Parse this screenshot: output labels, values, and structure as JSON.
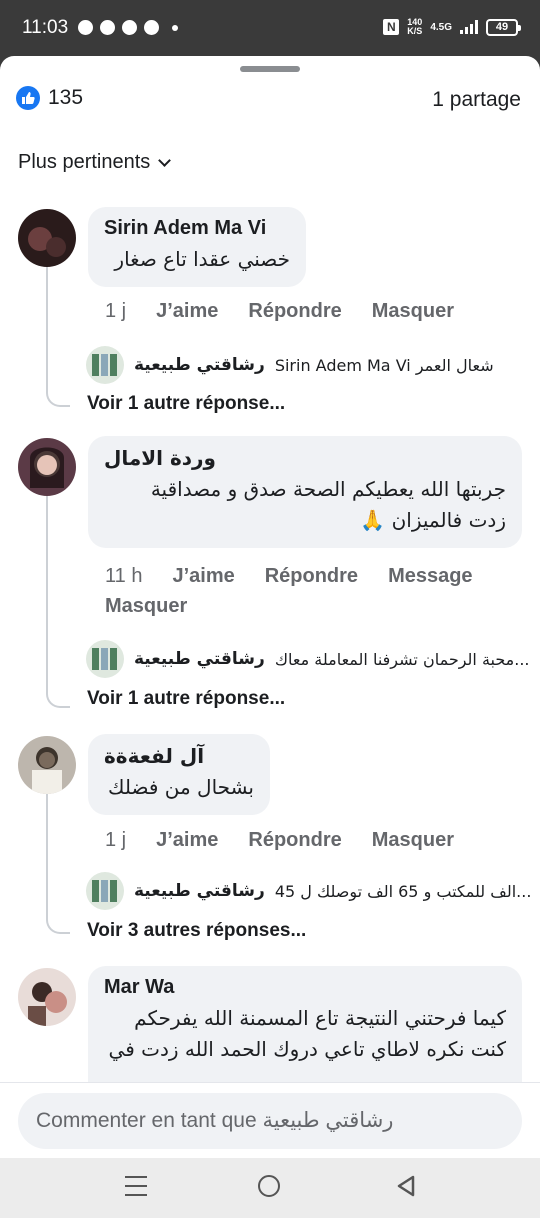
{
  "status_bar": {
    "time": "11:03",
    "speed_value": "140",
    "speed_unit": "K/S",
    "network": "4.5G",
    "battery": "49"
  },
  "post": {
    "like_count": "135",
    "shares": "1 partage",
    "sort_label": "Plus pertinents"
  },
  "comments": [
    {
      "author": "Sirin Adem Ma Vi",
      "text": [
        "خصني عقدا تاع صغار"
      ],
      "time": "1 j",
      "actions": [
        "J’aime",
        "Répondre",
        "Masquer"
      ],
      "reply_name": "رشاقتي طبيعية",
      "reply_text": "Sirin Adem Ma Vi شعال العمر",
      "more": "Voir 1 autre réponse..."
    },
    {
      "author": "وردة الامال",
      "text": [
        "جربتها الله يعطيكم الصحة صدق و مصداقية",
        "زدت فالميزان 🙏"
      ],
      "time": "11 h",
      "actions": [
        "J’aime",
        "Répondre",
        "Message"
      ],
      "actions_line2": "Masquer",
      "reply_name": "رشاقتي طبيعية",
      "reply_text": "محبة الرحمان تشرفنا المعاملة معاك...",
      "more": "Voir 1 autre réponse..."
    },
    {
      "author": "آل لفعةةة",
      "text": [
        "بشحال من فضلك"
      ],
      "time": "1 j",
      "actions": [
        "J’aime",
        "Répondre",
        "Masquer"
      ],
      "reply_name": "رشاقتي طبيعية",
      "reply_text": "45 الف للمكتب و 65 الف توصلك ل...",
      "more": "Voir 3 autres réponses..."
    },
    {
      "author": "Mar Wa",
      "text": [
        "كيما فرحتني النتيجة تاع المسمنة الله يفرحكم",
        "كنت نكره لاطاي تاعي دروك الحمد الله زدت في"
      ]
    }
  ],
  "compose": {
    "placeholder": "Commenter en tant que رشاقتي طبيعية"
  },
  "colors": {
    "accent": "#1877f2",
    "bubble": "#f0f2f5",
    "muted": "#65676b"
  }
}
